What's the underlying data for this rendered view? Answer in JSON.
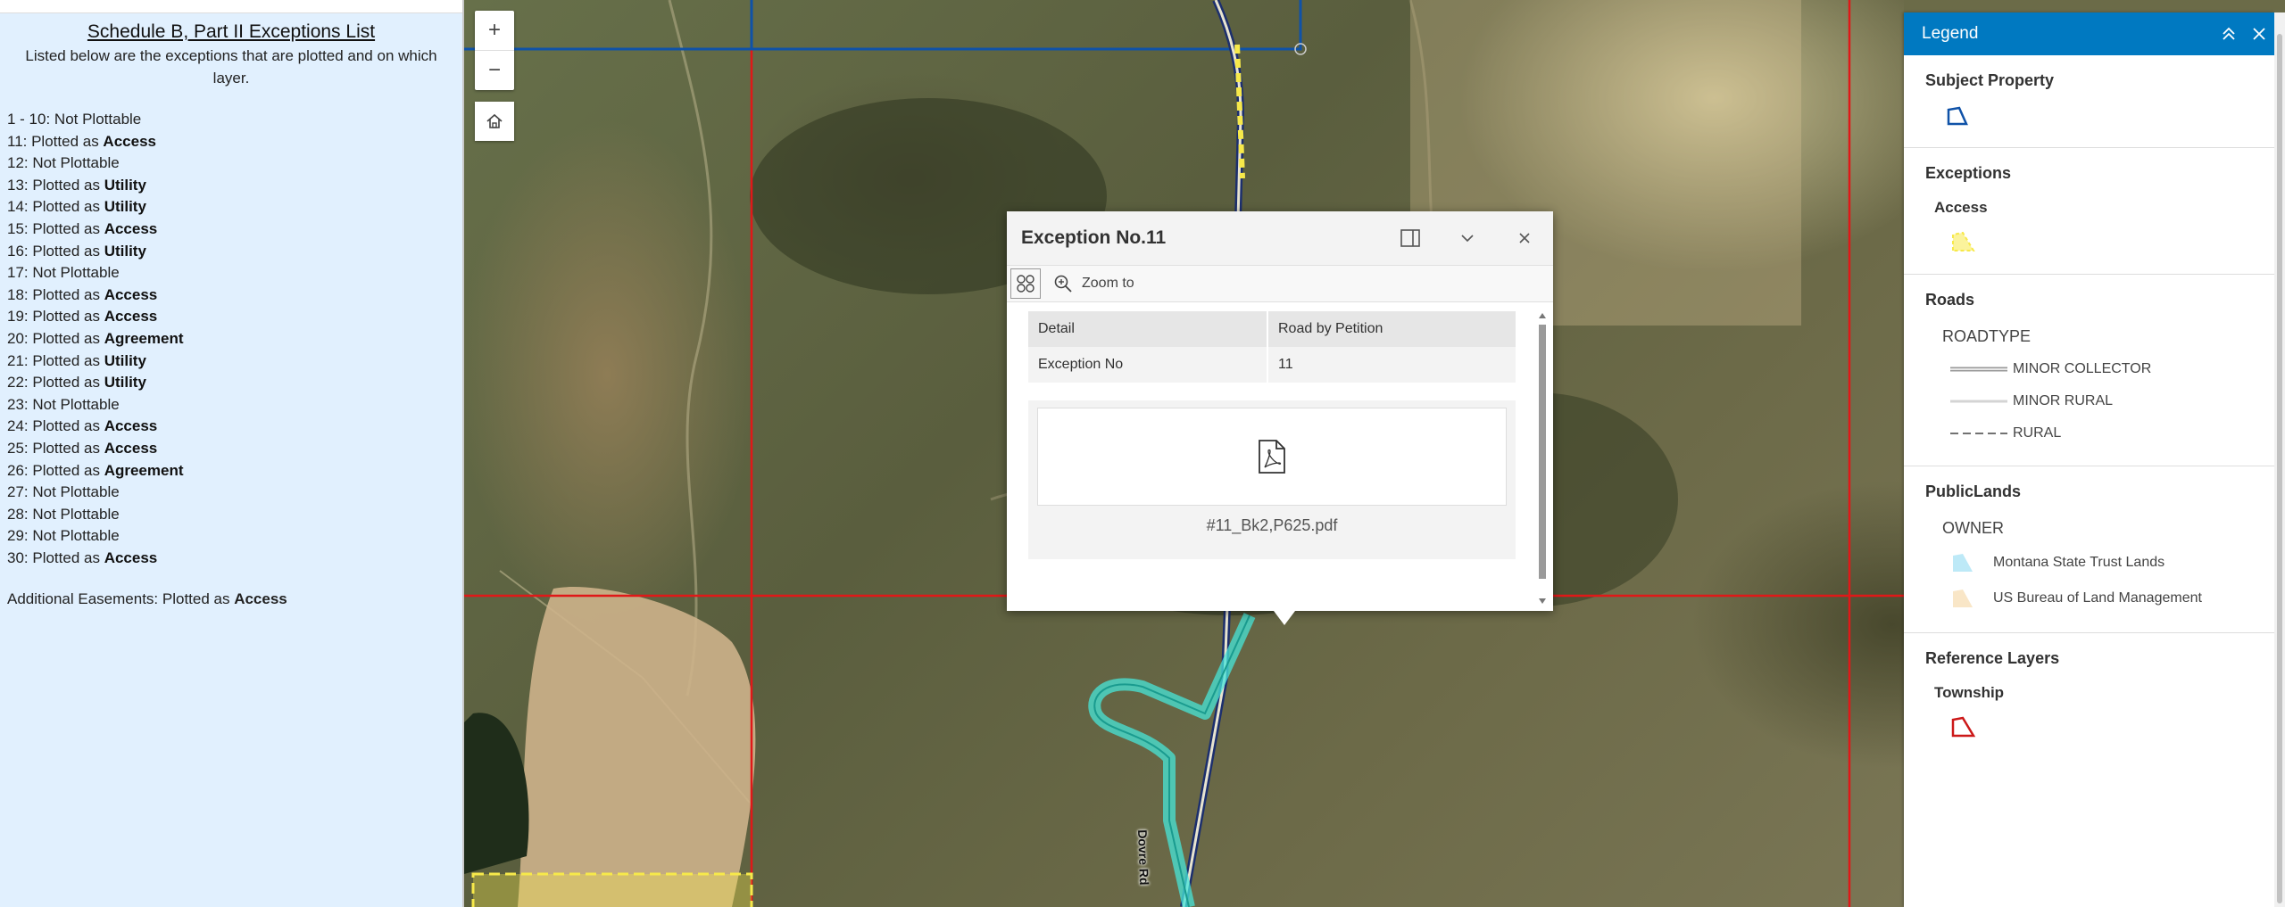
{
  "exceptions_panel": {
    "title": "Schedule B, Part II Exceptions List",
    "subtitle": "Listed below are the exceptions that are plotted and on which layer.",
    "rows": [
      {
        "prefix": "1 - 10: Not Plottable",
        "layer": ""
      },
      {
        "prefix": "11: Plotted as ",
        "layer": "Access"
      },
      {
        "prefix": "12: Not Plottable",
        "layer": ""
      },
      {
        "prefix": "13: Plotted as ",
        "layer": "Utility"
      },
      {
        "prefix": "14: Plotted as ",
        "layer": "Utility"
      },
      {
        "prefix": "15: Plotted as ",
        "layer": "Access"
      },
      {
        "prefix": "16: Plotted as ",
        "layer": "Utility"
      },
      {
        "prefix": "17: Not Plottable",
        "layer": ""
      },
      {
        "prefix": "18: Plotted as ",
        "layer": "Access"
      },
      {
        "prefix": "19: Plotted as ",
        "layer": "Access"
      },
      {
        "prefix": "20: Plotted as ",
        "layer": "Agreement"
      },
      {
        "prefix": "21: Plotted as ",
        "layer": "Utility"
      },
      {
        "prefix": "22: Plotted as ",
        "layer": "Utility"
      },
      {
        "prefix": "23: Not Plottable",
        "layer": ""
      },
      {
        "prefix": "24: Plotted as ",
        "layer": "Access"
      },
      {
        "prefix": "25: Plotted as ",
        "layer": "Access"
      },
      {
        "prefix": "26: Plotted as ",
        "layer": "Agreement"
      },
      {
        "prefix": "27: Not Plottable",
        "layer": ""
      },
      {
        "prefix": "28: Not Plottable",
        "layer": ""
      },
      {
        "prefix": "29: Not Plottable",
        "layer": ""
      },
      {
        "prefix": "30: Plotted as ",
        "layer": "Access"
      }
    ],
    "additional": {
      "prefix": "Additional Easements: Plotted as ",
      "layer": "Access"
    }
  },
  "map": {
    "zoom_in": "+",
    "zoom_out": "−",
    "road_label": "Dovre Rd"
  },
  "popup": {
    "title": "Exception No.11",
    "zoom_to": "Zoom to",
    "fields": [
      {
        "label": "Detail",
        "value": "Road by Petition"
      },
      {
        "label": "Exception No",
        "value": "11"
      }
    ],
    "attachment": "#11_Bk2,P625.pdf"
  },
  "legend": {
    "title": "Legend",
    "subject_property": "Subject Property",
    "exceptions": "Exceptions",
    "access": "Access",
    "roads": "Roads",
    "roadtype": "ROADTYPE",
    "road_items": [
      "MINOR COLLECTOR",
      "MINOR RURAL",
      "RURAL"
    ],
    "public_lands": "PublicLands",
    "owner": "OWNER",
    "owner_items": [
      "Montana State Trust Lands",
      "US Bureau of Land Management"
    ],
    "reference_layers": "Reference Layers",
    "township": "Township"
  },
  "colors": {
    "accent": "#0079c1",
    "township_line": "#e01818",
    "subject_line": "#0f52a8",
    "access_fill": "#f7e94a",
    "easement_glow": "#47e6d8",
    "panel_bg": "#e1f0fe"
  }
}
